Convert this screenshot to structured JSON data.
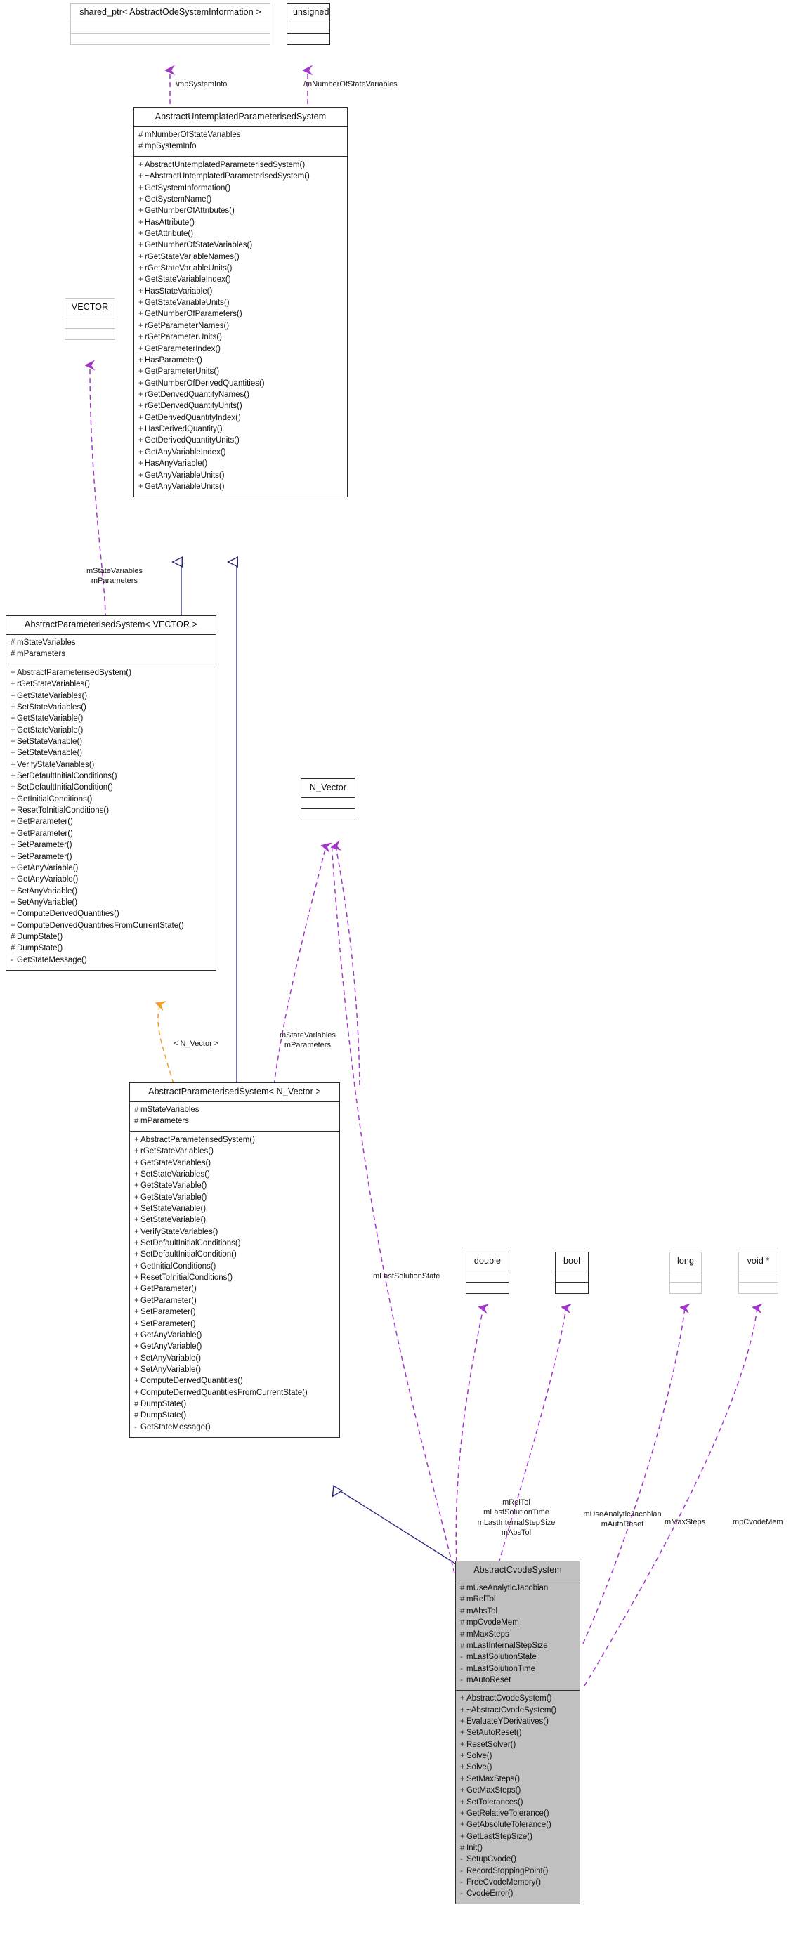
{
  "diagram": {
    "kind": "uml-class-collaboration-diagram",
    "title": "AbstractCvodeSystem collaboration diagram",
    "colors": {
      "background": "#ffffff",
      "node_border": "#2b2b2b",
      "node_border_muted": "#c8c8c8",
      "node_fill": "#ffffff",
      "node_fill_highlight": "#c0c0c0",
      "inheritance_edge": "#27277f",
      "template_edge": "#f0a030",
      "usage_edge": "#a238c8",
      "text": "#101010"
    }
  },
  "nodes": {
    "shared_ptr": {
      "name": "shared_ptr< AbstractOdeSystemInformation >",
      "attributes": [],
      "operations": [],
      "style": "muted"
    },
    "unsigned": {
      "name": "unsigned",
      "attributes": [],
      "operations": [],
      "style": "normal"
    },
    "vector": {
      "name": "VECTOR",
      "attributes": [],
      "operations": [],
      "style": "muted"
    },
    "n_vector": {
      "name": "N_Vector",
      "attributes": [],
      "operations": [],
      "style": "normal"
    },
    "double": {
      "name": "double",
      "attributes": [],
      "operations": [],
      "style": "normal"
    },
    "bool": {
      "name": "bool",
      "attributes": [],
      "operations": [],
      "style": "normal"
    },
    "long": {
      "name": "long",
      "attributes": [],
      "operations": [],
      "style": "muted"
    },
    "voidptr": {
      "name": "void *",
      "attributes": [],
      "operations": [],
      "style": "muted"
    },
    "untemplated": {
      "name": "AbstractUntemplatedParameterisedSystem",
      "attributes": [
        "# mNumberOfStateVariables",
        "# mpSystemInfo"
      ],
      "operations": [
        "+ AbstractUntemplatedParameterisedSystem()",
        "+ ~AbstractUntemplatedParameterisedSystem()",
        "+ GetSystemInformation()",
        "+ GetSystemName()",
        "+ GetNumberOfAttributes()",
        "+ HasAttribute()",
        "+ GetAttribute()",
        "+ GetNumberOfStateVariables()",
        "+ rGetStateVariableNames()",
        "+ rGetStateVariableUnits()",
        "+ GetStateVariableIndex()",
        "+ HasStateVariable()",
        "+ GetStateVariableUnits()",
        "+ GetNumberOfParameters()",
        "+ rGetParameterNames()",
        "+ rGetParameterUnits()",
        "+ GetParameterIndex()",
        "+ HasParameter()",
        "+ GetParameterUnits()",
        "+ GetNumberOfDerivedQuantities()",
        "+ rGetDerivedQuantityNames()",
        "+ rGetDerivedQuantityUnits()",
        "+ GetDerivedQuantityIndex()",
        "+ HasDerivedQuantity()",
        "+ GetDerivedQuantityUnits()",
        "+ GetAnyVariableIndex()",
        "+ HasAnyVariable()",
        "+ GetAnyVariableUnits()",
        "+ GetAnyVariableUnits()"
      ],
      "style": "normal"
    },
    "paramsys_vector": {
      "name": "AbstractParameterisedSystem< VECTOR >",
      "attributes": [
        "# mStateVariables",
        "# mParameters"
      ],
      "operations": [
        "+ AbstractParameterisedSystem()",
        "+ rGetStateVariables()",
        "+ GetStateVariables()",
        "+ SetStateVariables()",
        "+ GetStateVariable()",
        "+ GetStateVariable()",
        "+ SetStateVariable()",
        "+ SetStateVariable()",
        "+ VerifyStateVariables()",
        "+ SetDefaultInitialConditions()",
        "+ SetDefaultInitialCondition()",
        "+ GetInitialConditions()",
        "+ ResetToInitialConditions()",
        "+ GetParameter()",
        "+ GetParameter()",
        "+ SetParameter()",
        "+ SetParameter()",
        "+ GetAnyVariable()",
        "+ GetAnyVariable()",
        "+ SetAnyVariable()",
        "+ SetAnyVariable()",
        "+ ComputeDerivedQuantities()",
        "+ ComputeDerivedQuantitiesFromCurrentState()",
        "# DumpState()",
        "# DumpState()",
        "- GetStateMessage()"
      ],
      "style": "normal"
    },
    "paramsys_nvector": {
      "name": "AbstractParameterisedSystem< N_Vector >",
      "attributes": [
        "# mStateVariables",
        "# mParameters"
      ],
      "operations": [
        "+ AbstractParameterisedSystem()",
        "+ rGetStateVariables()",
        "+ GetStateVariables()",
        "+ SetStateVariables()",
        "+ GetStateVariable()",
        "+ GetStateVariable()",
        "+ SetStateVariable()",
        "+ SetStateVariable()",
        "+ VerifyStateVariables()",
        "+ SetDefaultInitialConditions()",
        "+ SetDefaultInitialCondition()",
        "+ GetInitialConditions()",
        "+ ResetToInitialConditions()",
        "+ GetParameter()",
        "+ GetParameter()",
        "+ SetParameter()",
        "+ SetParameter()",
        "+ GetAnyVariable()",
        "+ GetAnyVariable()",
        "+ SetAnyVariable()",
        "+ SetAnyVariable()",
        "+ ComputeDerivedQuantities()",
        "+ ComputeDerivedQuantitiesFromCurrentState()",
        "# DumpState()",
        "# DumpState()",
        "- GetStateMessage()"
      ],
      "style": "normal"
    },
    "cvode": {
      "name": "AbstractCvodeSystem",
      "attributes": [
        "# mUseAnalyticJacobian",
        "# mRelTol",
        "# mAbsTol",
        "# mpCvodeMem",
        "# mMaxSteps",
        "# mLastInternalStepSize",
        "- mLastSolutionState",
        "- mLastSolutionTime",
        "- mAutoReset"
      ],
      "operations": [
        "+ AbstractCvodeSystem()",
        "+ ~AbstractCvodeSystem()",
        "+ EvaluateYDerivatives()",
        "+ SetAutoReset()",
        "+ ResetSolver()",
        "+ Solve()",
        "+ Solve()",
        "+ SetMaxSteps()",
        "+ GetMaxSteps()",
        "+ SetTolerances()",
        "+ GetRelativeTolerance()",
        "+ GetAbsoluteTolerance()",
        "+ GetLastStepSize()",
        "# Init()",
        "- SetupCvode()",
        "- RecordStoppingPoint()",
        "- FreeCvodeMemory()",
        "- CvodeError()"
      ],
      "style": "highlight"
    }
  },
  "edge_labels": {
    "mp_system_info": "\\mpSystemInfo",
    "m_number_of_state_variables": "/mNumberOfStateVariables",
    "state_vars_params_vector": "mStateVariables\nmParameters",
    "template_n_vector": "< N_Vector >",
    "state_vars_params_nvector": "mStateVariables\nmParameters",
    "m_last_solution_state": "mLastSolutionState",
    "double_group": "mRelTol\nmLastSolutionTime\nmLastInternalStepSize\nmAbsTol",
    "bool_group": "mUseAnalyticJacobian\nmAutoReset",
    "m_max_steps": "mMaxSteps",
    "mp_cvode_mem": "mpCvodeMem"
  }
}
